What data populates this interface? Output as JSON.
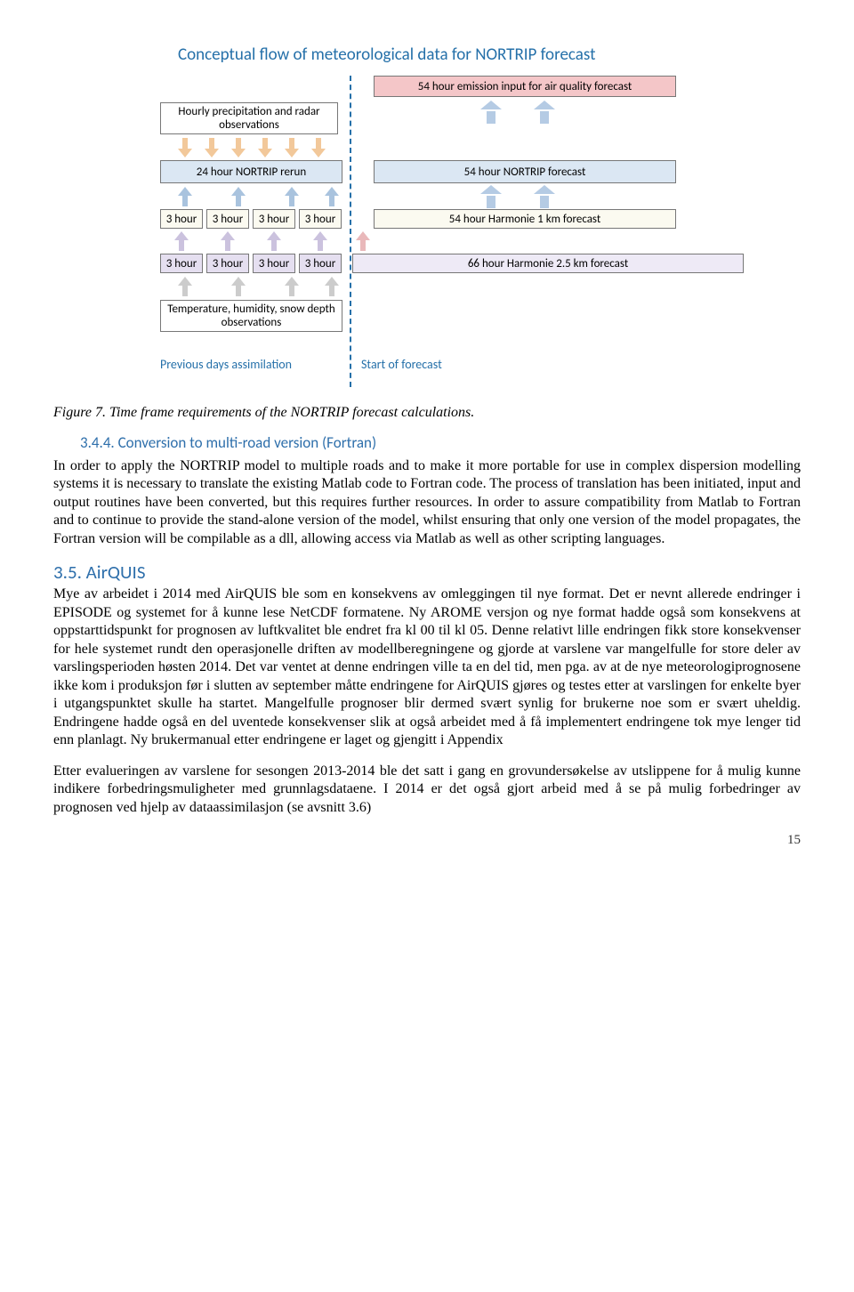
{
  "diagram": {
    "title": "Conceptual flow of meteorological data for NORTRIP forecast",
    "boxes": {
      "emission": "54 hour emission input for air quality forecast",
      "precip": "Hourly precipitation and radar observations",
      "rerun": "24 hour NORTRIP rerun",
      "nforecast": "54 hour NORTRIP forecast",
      "harmonie1": "54 hour Harmonie 1 km forecast",
      "harmonie25": "66 hour Harmonie 2.5 km forecast",
      "temp_obs": "Temperature, humidity, snow depth observations",
      "cell3h": "3 hour"
    },
    "legend": {
      "left": "Previous days assimilation",
      "right": "Start of forecast"
    }
  },
  "caption": "Figure 7. Time frame requirements of the NORTRIP forecast calculations.",
  "sec344": {
    "heading": "3.4.4. Conversion to multi-road version (Fortran)",
    "text": "In order to apply the NORTRIP model to multiple roads and to make it more portable for use in complex dispersion modelling systems it is necessary to translate the existing Matlab code to Fortran code. The process of translation has been initiated, input and output routines have been converted, but this requires further resources. In order to assure compatibility from Matlab to Fortran and to continue to provide the stand-alone version of the model, whilst ensuring that only one version of the model propagates, the Fortran version will be compilable as a dll, allowing access via Matlab as well as other scripting languages."
  },
  "sec35": {
    "heading": "3.5. AirQUIS",
    "p1": "Mye av arbeidet i 2014 med AirQUIS ble som en konsekvens av omleggingen til nye format. Det er nevnt allerede endringer i EPISODE og systemet for å kunne lese NetCDF formatene. Ny AROME versjon og nye format hadde også som konsekvens at oppstarttidspunkt for prognosen av luftkvalitet ble endret fra kl 00 til kl 05. Denne relativt lille endringen fikk store konsekvenser for hele systemet rundt den operasjonelle driften av modellberegningene og gjorde at varslene var mangelfulle for store deler av varslingsperioden høsten 2014. Det var ventet at denne endringen ville ta en del tid, men pga. av at de nye meteorologiprognosene ikke kom i produksjon før i slutten av september måtte endringene for AirQUIS gjøres og testes etter at varslingen for enkelte byer i utgangspunktet skulle ha startet. Mangelfulle prognoser blir dermed svært synlig for brukerne noe som er svært uheldig. Endringene hadde også en del uventede konsekvenser slik at også arbeidet med å få implementert endringene tok mye lenger tid enn planlagt. Ny brukermanual etter endringene er laget og gjengitt i Appendix",
    "p2": "Etter evalueringen av varslene for sesongen 2013-2014 ble det satt i gang en grovundersøkelse av utslippene for å mulig kunne indikere forbedringsmuligheter med grunnlagsdataene. I 2014 er det også gjort arbeid med å se på mulig forbedringer av prognosen ved hjelp av dataassimilasjon (se avsnitt 3.6)"
  },
  "page": "15"
}
